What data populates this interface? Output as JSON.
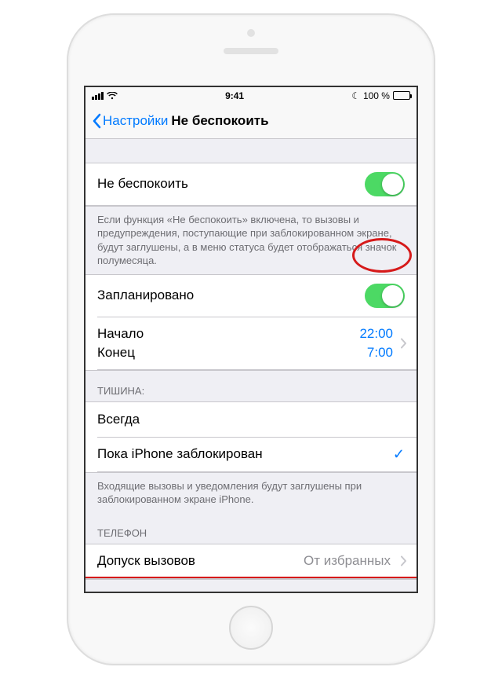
{
  "status_bar": {
    "time": "9:41",
    "battery_text": "100 %",
    "moon_glyph": "☾"
  },
  "nav": {
    "back_label": "Настройки",
    "title": "Не беспокоить"
  },
  "dnd": {
    "label": "Не беспокоить",
    "footer": "Если функция «Не беспокоить» включена, то вызовы и предупреждения, поступающие при заблокированном экране, будут заглушены, а в меню статуса будет отображаться значок полумесяца."
  },
  "scheduled": {
    "label": "Запланировано",
    "from_label": "Начало",
    "from_value": "22:00",
    "to_label": "Конец",
    "to_value": "7:00"
  },
  "silence": {
    "header": "ТИШИНА:",
    "always": "Всегда",
    "while_locked": "Пока iPhone заблокирован",
    "footer": "Входящие вызовы и уведомления будут заглушены при заблокированном экране iPhone."
  },
  "phone": {
    "header": "ТЕЛЕФОН",
    "allow_calls_label": "Допуск вызовов",
    "allow_calls_value": "От избранных"
  }
}
